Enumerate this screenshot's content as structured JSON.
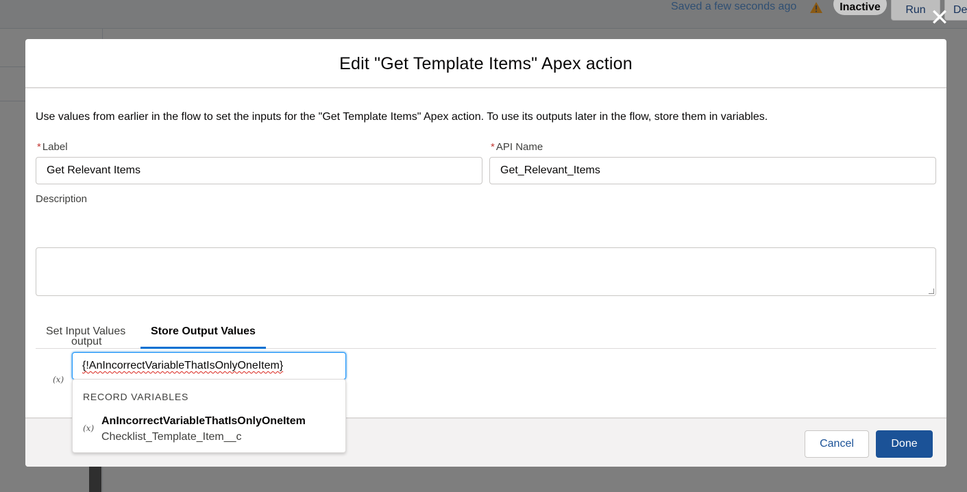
{
  "topbar": {
    "saved_status": "Saved a few seconds ago",
    "status_badge": "Inactive",
    "run_label": "Run",
    "debug_label": "De"
  },
  "modal": {
    "title": "Edit \"Get Template Items\" Apex action",
    "intro": "Use values from earlier in the flow to set the inputs for the \"Get Template Items\" Apex action. To use its outputs later in the flow, store them in variables.",
    "label_field": {
      "label": "Label",
      "value": "Get Relevant Items"
    },
    "api_name_field": {
      "label": "API Name",
      "value": "Get_Relevant_Items"
    },
    "description_field": {
      "label": "Description",
      "value": ""
    },
    "tabs": [
      {
        "label": "Set Input Values",
        "active": false
      },
      {
        "label": "Store Output Values",
        "active": true
      }
    ],
    "output": {
      "label": "output",
      "value": "{!AnIncorrectVariableThatIsOnlyOneItem}"
    },
    "dropdown": {
      "heading": "RECORD VARIABLES",
      "items": [
        {
          "name": "AnIncorrectVariableThatIsOnlyOneItem",
          "type": "Checklist_Template_Item__c"
        }
      ]
    },
    "footer": {
      "cancel_label": "Cancel",
      "done_label": "Done"
    }
  },
  "icons": {
    "close": "close-icon",
    "warning": "warning-icon",
    "variable": "variable-icon"
  },
  "colors": {
    "brand": "#1b5297",
    "focus": "#1b96ff",
    "required": "#c23934",
    "warning": "#dd7a01"
  }
}
